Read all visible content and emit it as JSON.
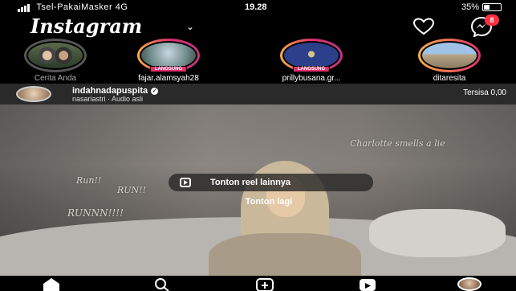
{
  "status_bar": {
    "carrier": "Tsel-PakaiMasker 4G",
    "time": "19.28",
    "battery": "35%"
  },
  "header": {
    "logo": "Instagram",
    "icons": [
      "chevron-down-icon",
      "heart-icon",
      "messenger-icon"
    ],
    "unread_count": "8"
  },
  "stories": [
    {
      "name": "Cerita Anda",
      "live": false
    },
    {
      "name": "fajar.alamsyah28",
      "live": true,
      "live_label": "LANGSUNG"
    },
    {
      "name": "prillybusana.gr...",
      "live": true,
      "live_label": "LANGSUNG"
    },
    {
      "name": "ditaresita",
      "live": false
    }
  ],
  "post": {
    "username": "indahnadapuspita",
    "subtitle": "nasariastri · Audio asli",
    "remaining": "Tersisa 0,00",
    "video_text": {
      "caption_right": "Charlotte smells a lie",
      "run1": "Run!!",
      "run2": "RUN!!",
      "run3": "RUNNN!!!!"
    },
    "watch_more_label": "Tonton reel lainnya",
    "watch_again_label": "Tonton lagi"
  },
  "bottom_nav": [
    "home-icon",
    "search-icon",
    "create-icon",
    "reels-icon",
    "profile-avatar"
  ],
  "colors": {
    "background": "#000000",
    "badge": "#ff3040",
    "live": "#e1306c"
  }
}
